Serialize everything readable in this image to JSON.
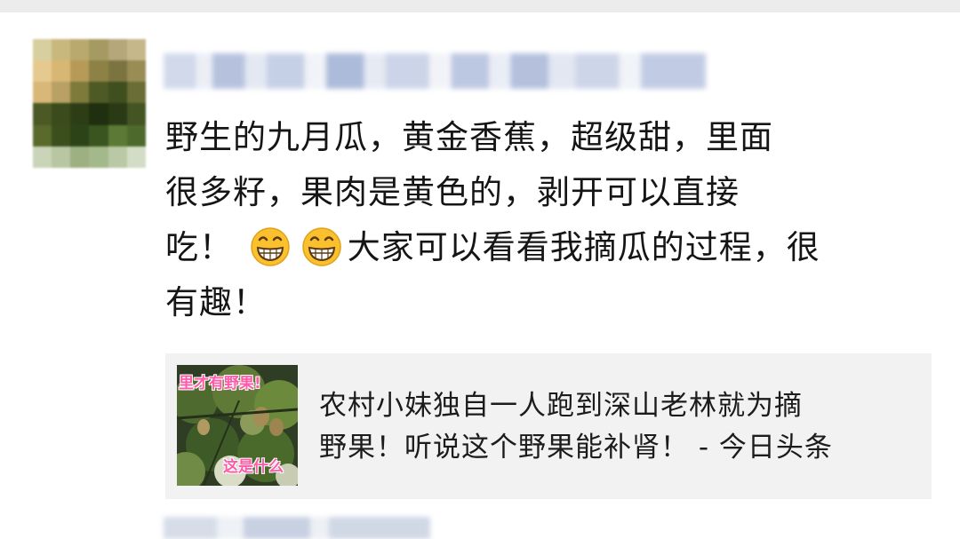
{
  "post": {
    "text_line_1": "野生的九月瓜，黄金香蕉，超级甜，里面",
    "text_line_2": "很多籽，果肉是黄色的，剥开可以直接",
    "text_line_3a": "吃！",
    "text_line_3b": "大家可以看看我摘瓜的过程，很",
    "text_line_4": "有趣！",
    "emojis": [
      "grinning-face-icon",
      "grinning-face-icon"
    ]
  },
  "link_card": {
    "thumbnail_text_top": "里才有野果!",
    "thumbnail_text_bottom": "这是什么",
    "title_line_1": "农村小妹独自一人跑到深山老林就为摘",
    "title_line_2": "野果！听说这个野果能补肾！ - 今日头条"
  },
  "colors": {
    "text": "#151515",
    "card_background": "#f2f2f2",
    "thumbnail_overlay_text": "#ff5aa8"
  }
}
